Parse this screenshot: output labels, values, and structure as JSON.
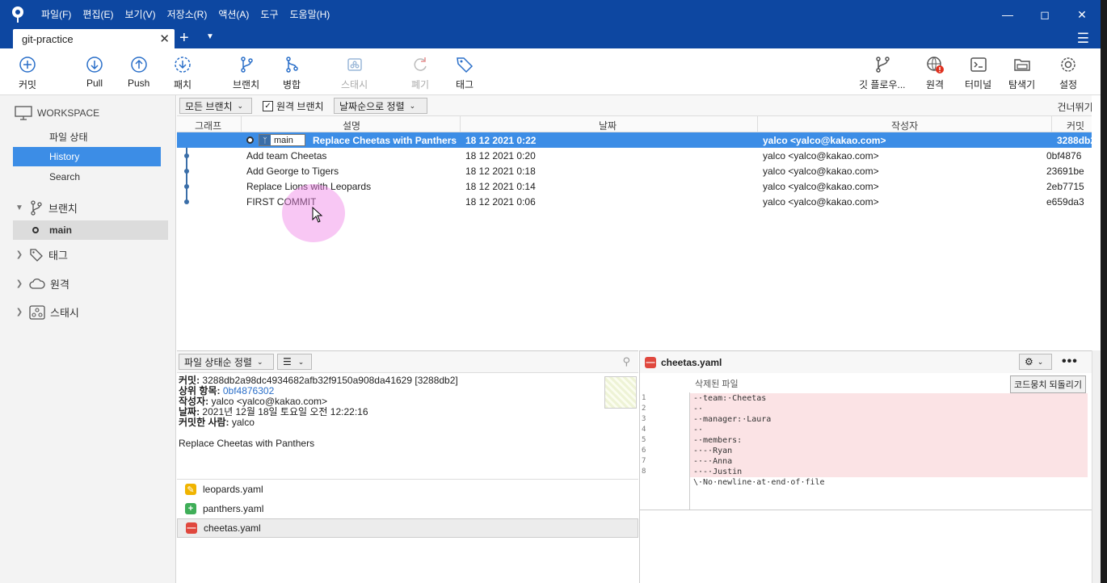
{
  "menu": [
    "파일(F)",
    "편집(E)",
    "보기(V)",
    "저장소(R)",
    "액션(A)",
    "도구",
    "도움말(H)"
  ],
  "tab": {
    "title": "git-practice"
  },
  "toolbar": {
    "commit": "커밋",
    "pull": "Pull",
    "push": "Push",
    "fetch": "패치",
    "branch": "브랜치",
    "merge": "병합",
    "stash": "스태시",
    "discard": "폐기",
    "tag": "태그",
    "gitflow": "깃 플로우...",
    "remote": "원격",
    "terminal": "터미널",
    "explorer": "탐색기",
    "settings": "설정"
  },
  "sidebar": {
    "workspace": "WORKSPACE",
    "file_status": "파일 상태",
    "history": "History",
    "search": "Search",
    "branches": "브랜치",
    "branch_main": "main",
    "tags": "태그",
    "remotes": "원격",
    "stashes": "스태시"
  },
  "filters": {
    "branches": "모든 브랜치",
    "remote_branches": "원격 브랜치",
    "sort": "날짜순으로 정렬",
    "jump": "건너뛰기:"
  },
  "columns": {
    "graph": "그래프",
    "description": "설명",
    "date": "날짜",
    "author": "작성자",
    "commit": "커밋"
  },
  "commits": [
    {
      "branch": "main",
      "message": "Replace Cheetas with Panthers",
      "date": "18 12 2021 0:22",
      "author": "yalco <yalco@kakao.com>",
      "hash": "3288db2"
    },
    {
      "message": "Add team Cheetas",
      "date": "18 12 2021 0:20",
      "author": "yalco <yalco@kakao.com>",
      "hash": "0bf4876"
    },
    {
      "message": "Add George to Tigers",
      "date": "18 12 2021 0:18",
      "author": "yalco <yalco@kakao.com>",
      "hash": "23691be"
    },
    {
      "message": "Replace Lions with Leopards",
      "date": "18 12 2021 0:14",
      "author": "yalco <yalco@kakao.com>",
      "hash": "2eb7715"
    },
    {
      "message": "FIRST COMMIT",
      "date": "18 12 2021 0:06",
      "author": "yalco <yalco@kakao.com>",
      "hash": "e659da3"
    }
  ],
  "bottom_left": {
    "sort": "파일 상태순 정렬"
  },
  "details": {
    "commit_label": "커밋:",
    "commit_value": "3288db2a98dc4934682afb32f9150a908da41629 [3288db2]",
    "parent_label": "상위 항목:",
    "parent_value": "0bf4876302",
    "author_label": "작성자:",
    "author_value": "yalco <yalco@kakao.com>",
    "date_label": "날짜:",
    "date_value": "2021년 12월 18일 토요일 오전 12:22:16",
    "committer_label": "커밋한 사람:",
    "committer_value": "yalco",
    "message": "Replace Cheetas with Panthers"
  },
  "files": [
    {
      "name": "leopards.yaml",
      "status": "modified",
      "color": "#f0b400"
    },
    {
      "name": "panthers.yaml",
      "status": "added",
      "color": "#3fae58"
    },
    {
      "name": "cheetas.yaml",
      "status": "removed",
      "color": "#e0483e"
    }
  ],
  "diff": {
    "filename": "cheetas.yaml",
    "hunk_label": "삭제된 파일",
    "revert_label": "코드뭉치 되돌리기",
    "lines": [
      {
        "n": "1",
        "text": "-·team:·Cheetas"
      },
      {
        "n": "2",
        "text": "-·"
      },
      {
        "n": "3",
        "text": "-·manager:·Laura"
      },
      {
        "n": "4",
        "text": "-·"
      },
      {
        "n": "5",
        "text": "-·members:"
      },
      {
        "n": "6",
        "text": "-·-·Ryan"
      },
      {
        "n": "7",
        "text": "-·-·Anna"
      },
      {
        "n": "8",
        "text": "-·-·Justin"
      }
    ],
    "no_newline": "\\·No·newline·at·end·of·file"
  },
  "colors": {
    "accent": "#0d47a1",
    "selection": "#3c8de6",
    "deleted_line": "#fbe3e5"
  }
}
